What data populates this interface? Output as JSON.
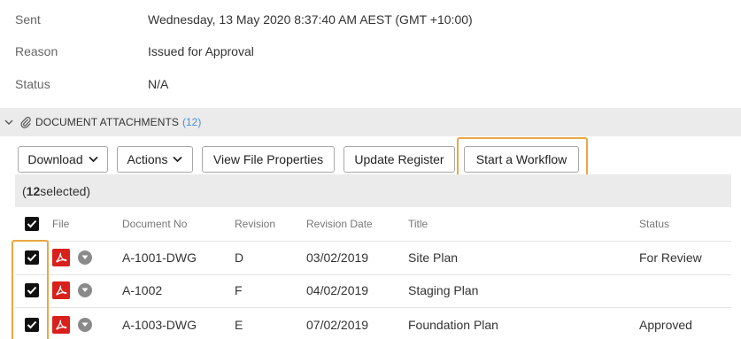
{
  "details": {
    "sent_label": "Sent",
    "sent_value": "Wednesday, 13 May 2020 8:37:40 AM AEST (GMT +10:00)",
    "reason_label": "Reason",
    "reason_value": "Issued for Approval",
    "status_label": "Status",
    "status_value": "N/A"
  },
  "attachments": {
    "title": "DOCUMENT ATTACHMENTS",
    "count": "(12)"
  },
  "toolbar": {
    "download": "Download",
    "actions": "Actions",
    "view_props": "View File Properties",
    "update_register": "Update Register",
    "start_workflow": "Start a Workflow"
  },
  "selection": {
    "prefix": "(",
    "count": "12",
    "suffix": " selected)"
  },
  "table": {
    "headers": {
      "file": "File",
      "doc_no": "Document No",
      "revision": "Revision",
      "revision_date": "Revision Date",
      "title": "Title",
      "status": "Status"
    },
    "rows": [
      {
        "doc_no": "A-1001-DWG",
        "revision": "D",
        "revision_date": "03/02/2019",
        "title": "Site Plan",
        "status": "For Review"
      },
      {
        "doc_no": "A-1002",
        "revision": "F",
        "revision_date": "04/02/2019",
        "title": "Staging Plan",
        "status": ""
      },
      {
        "doc_no": "A-1003-DWG",
        "revision": "E",
        "revision_date": "07/02/2019",
        "title": "Foundation Plan",
        "status": "Approved"
      }
    ]
  },
  "colors": {
    "highlight": "#e8a845",
    "pdf_red": "#d8201c",
    "link_blue": "#4a90d9"
  },
  "icons": {
    "collapse": "chevron-down-icon",
    "attachment": "paperclip-icon",
    "file": "pdf-icon",
    "row_menu": "dropdown-circle-icon",
    "checkbox": "checkbox-checked-icon"
  }
}
